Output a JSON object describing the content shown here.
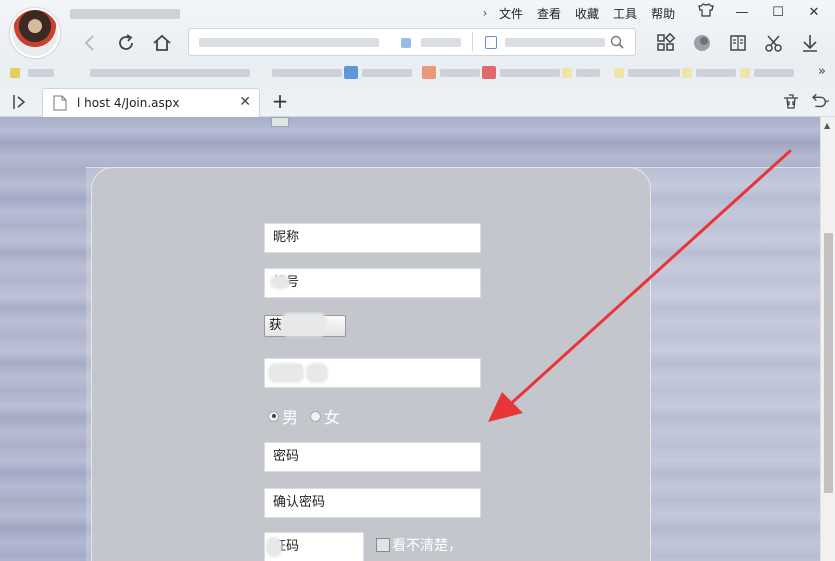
{
  "menu": {
    "items": [
      "文件",
      "查看",
      "收藏",
      "工具",
      "帮助"
    ]
  },
  "tab": {
    "title": "l    host      4/Join.aspx",
    "close": "✕",
    "new": "+"
  },
  "form": {
    "nickname_placeholder": "昵称",
    "phone_placeholder": "  机号",
    "get_code_label": "获      码",
    "sms_code_placeholder": "     验  码",
    "gender_male": "男",
    "gender_female": "女",
    "password_placeholder": "密码",
    "confirm_password_placeholder": "确认密码",
    "captcha_placeholder": " 证码",
    "captcha_alt": "看不清楚，"
  },
  "colors": {
    "arrow": "#e8353a",
    "panel": "#c4c6cb",
    "page_bg": "#aab0ca"
  },
  "selected_gender": "男"
}
